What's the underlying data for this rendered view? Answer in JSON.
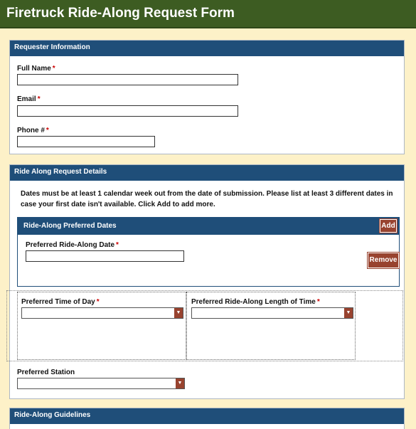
{
  "page": {
    "title": "Firetruck Ride-Along Request Form"
  },
  "requester": {
    "header": "Requester Information",
    "full_name_label": "Full Name",
    "full_name_value": "",
    "email_label": "Email",
    "email_value": "",
    "phone_label": "Phone #",
    "phone_value": "",
    "required_mark": "*"
  },
  "details": {
    "header": "Ride Along Request Details",
    "notice": "Dates must be at least 1 calendar week out from the date of submission. Please list at least 3 different dates in case your first date isn't available. Click Add to add more.",
    "dates_panel": {
      "header": "Ride-Along Preferred Dates",
      "add_label": "Add",
      "date_label": "Preferred Ride-Along Date",
      "date_value": "",
      "remove_label": "Remove"
    },
    "time_of_day_label": "Preferred Time of Day",
    "time_of_day_value": "",
    "length_label": "Preferred Ride-Along Length of Time",
    "length_value": "",
    "station_label": "Preferred Station",
    "station_value": ""
  },
  "guidelines": {
    "header": "Ride-Along Guidelines"
  },
  "icons": {
    "dropdown": "chevron-down-icon"
  },
  "colors": {
    "title_bar": "#3d5c22",
    "panel_header": "#1f4e79",
    "button": "#98432f",
    "page_background": "#fdf1c8",
    "required": "#cc0000"
  }
}
